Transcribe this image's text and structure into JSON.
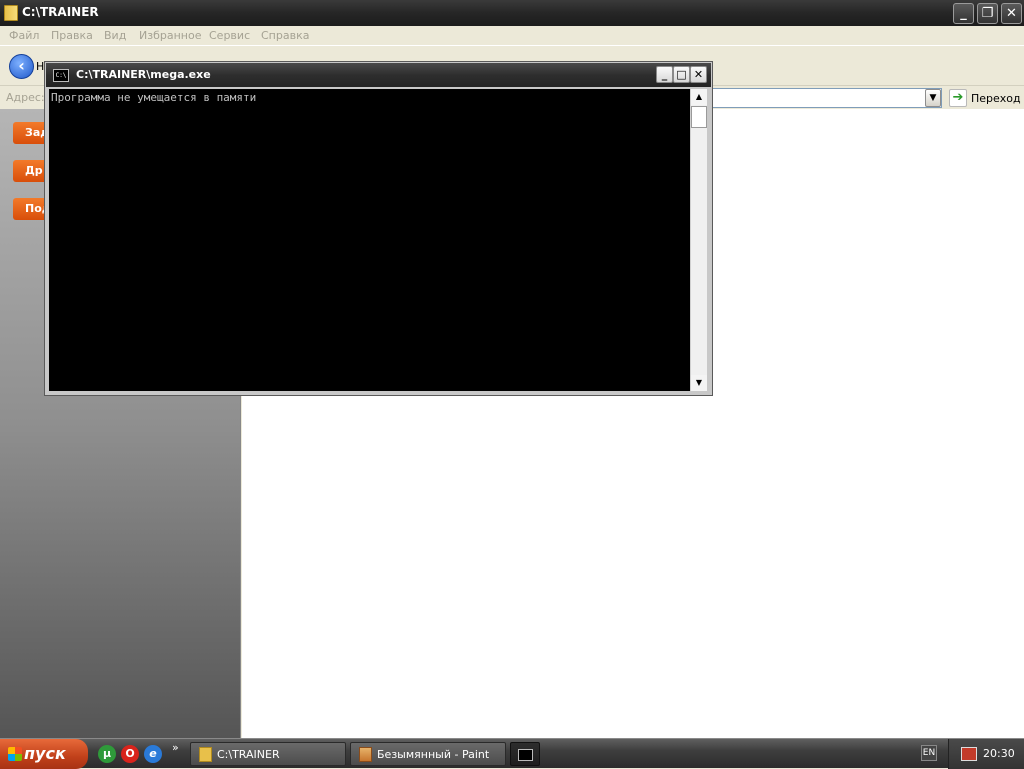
{
  "explorer": {
    "title": "C:\\TRAINER",
    "menu": [
      "Файл",
      "Правка",
      "Вид",
      "Избранное",
      "Сервис",
      "Справка"
    ],
    "back_label": "Н",
    "address_label": "Адрес:",
    "go_label": "Переход",
    "task_headers": [
      "Зад",
      "Др",
      "Под"
    ]
  },
  "console": {
    "title": "C:\\TRAINER\\mega.exe",
    "icon_text": "C:\\",
    "output": "Программа не умещается в памяти"
  },
  "taskbar": {
    "start_label": "пуск",
    "quicklaunch": [
      "utorrent-icon",
      "opera-icon",
      "ie-icon"
    ],
    "buttons": [
      {
        "label": "C:\\TRAINER",
        "icon": "folder-icon"
      },
      {
        "label": "Безымянный - Paint",
        "icon": "paint-icon"
      },
      {
        "label": "",
        "icon": "console-icon"
      }
    ],
    "language": "EN",
    "clock": "20:30"
  }
}
